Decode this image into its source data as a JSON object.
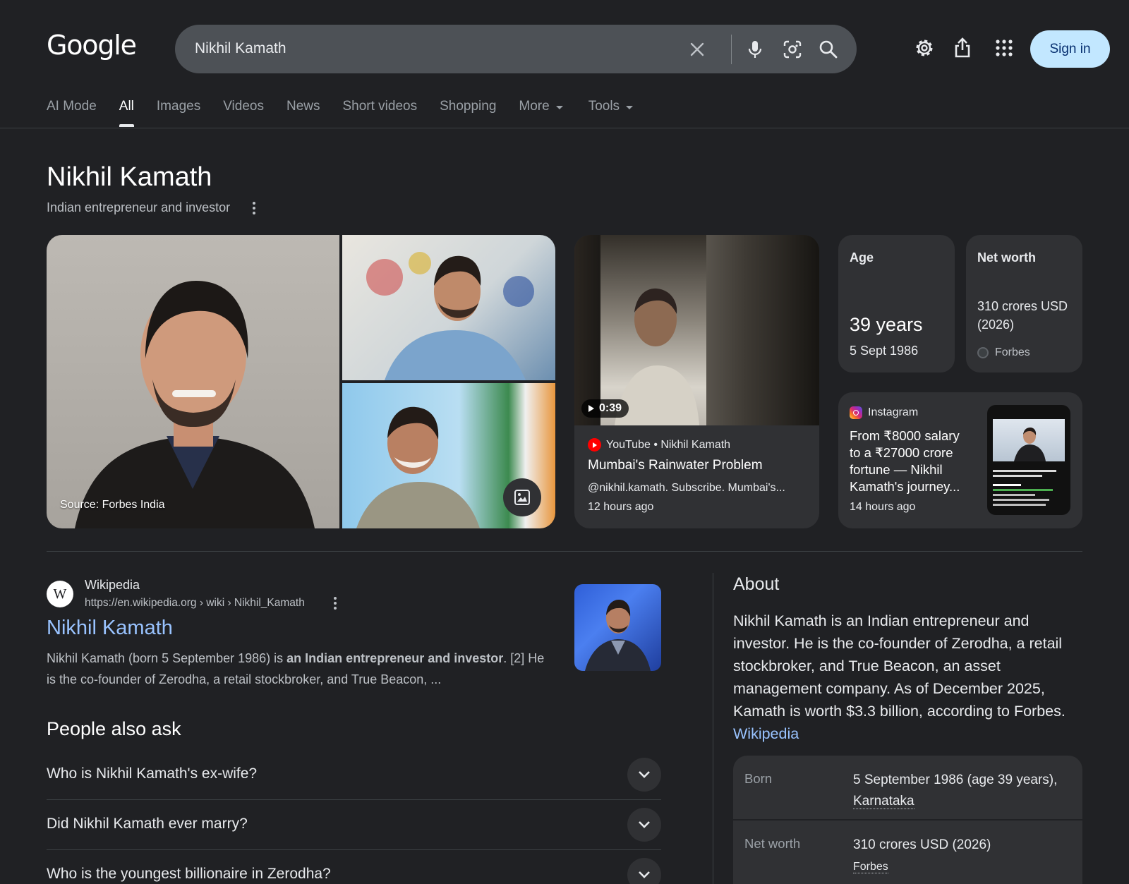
{
  "header": {
    "logo": "Google",
    "query": "Nikhil Kamath",
    "sign_in": "Sign in"
  },
  "tabs": [
    {
      "label": "AI Mode"
    },
    {
      "label": "All"
    },
    {
      "label": "Images"
    },
    {
      "label": "Videos"
    },
    {
      "label": "News"
    },
    {
      "label": "Short videos"
    },
    {
      "label": "Shopping"
    },
    {
      "label": "More"
    },
    {
      "label": "Tools"
    }
  ],
  "active_tab": "All",
  "entity": {
    "title": "Nikhil Kamath",
    "subtitle": "Indian entrepreneur and investor"
  },
  "images": {
    "source_caption": "Source: Forbes India"
  },
  "video": {
    "duration": "0:39",
    "source": "YouTube • Nikhil Kamath",
    "title": "Mumbai's Rainwater Problem",
    "description": "@nikhil.kamath. Subscribe. Mumbai's...",
    "time": "12 hours ago"
  },
  "age_card": {
    "label": "Age",
    "value": "39 years",
    "date": "5 Sept 1986"
  },
  "networth_card": {
    "label": "Net worth",
    "value": "310 crores USD (2026)",
    "source": "Forbes"
  },
  "instagram_card": {
    "source": "Instagram",
    "title": "From ₹8000 salary to a ₹27000 crore fortune — Nikhil Kamath's journey...",
    "time": "14 hours ago"
  },
  "wiki_result": {
    "site": "Wikipedia",
    "url": "https://en.wikipedia.org › wiki › Nikhil_Kamath",
    "title": "Nikhil Kamath",
    "snippet_a": "Nikhil Kamath (born 5 September 1986) is ",
    "snippet_bold": "an Indian entrepreneur and investor",
    "snippet_b": ". [2] He is the co-founder of Zerodha, a retail stockbroker, and True Beacon,  ..."
  },
  "people_also_ask": {
    "title": "People also ask",
    "questions": [
      "Who is Nikhil Kamath's ex-wife?",
      "Did Nikhil Kamath ever marry?",
      "Who is the youngest billionaire in Zerodha?"
    ]
  },
  "about": {
    "heading": "About",
    "text": "Nikhil Kamath is an Indian entrepreneur and investor. He is the co-founder of Zerodha, a retail stockbroker, and True Beacon, an asset management company. As of December 2025, Kamath is worth $3.3 billion, according to Forbes.",
    "link": "Wikipedia",
    "facts": {
      "born_label": "Born",
      "born_value": "5 September 1986 (age 39 years),",
      "born_place": "Karnataka",
      "networth_label": "Net worth",
      "networth_value": "310 crores USD (2026)",
      "networth_source": "Forbes"
    }
  },
  "colors": {
    "background": "#202124",
    "surface": "#303134",
    "link": "#99c3ff",
    "sign_in_bg": "#c2e7ff"
  }
}
